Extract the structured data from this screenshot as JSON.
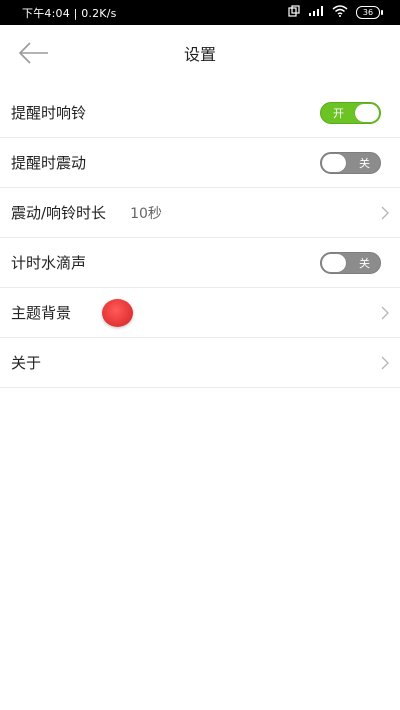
{
  "status_bar": {
    "time_speed": "下午4:04 | 0.2K/s",
    "battery": "36"
  },
  "header": {
    "title": "设置"
  },
  "settings": {
    "alarm_ring": {
      "label": "提醒时响铃",
      "toggle_text": "开",
      "state": "on"
    },
    "alarm_vibrate": {
      "label": "提醒时震动",
      "toggle_text": "关",
      "state": "off"
    },
    "duration": {
      "label": "震动/响铃时长",
      "value": "10秒"
    },
    "water_drop": {
      "label": "计时水滴声",
      "toggle_text": "关",
      "state": "off"
    },
    "theme_bg": {
      "label": "主题背景",
      "color": "#e83a3a"
    },
    "about": {
      "label": "关于"
    }
  },
  "colors": {
    "toggle_on": "#6cc324",
    "toggle_off": "#8c8c8c"
  }
}
